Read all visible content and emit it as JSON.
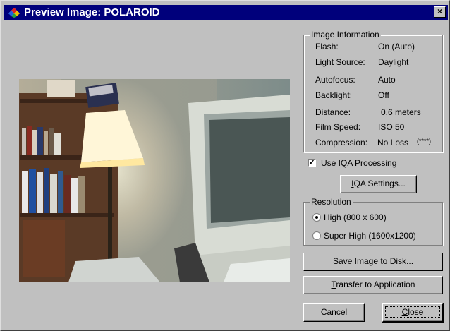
{
  "window": {
    "title": "Preview Image: POLAROID",
    "close_glyph": "×"
  },
  "image_information": {
    "legend": "Image Information",
    "rows": [
      {
        "label": "Flash:",
        "value": "On (Auto)"
      },
      {
        "label": "Light Source:",
        "value": "Daylight"
      },
      {
        "label": "Autofocus:",
        "value": "Auto"
      },
      {
        "label": "Backlight:",
        "value": "Off"
      },
      {
        "label": "Distance:",
        "value": "0.6 meters"
      },
      {
        "label": "Film Speed:",
        "value": "ISO 50"
      },
      {
        "label": "Compression:",
        "value": "No Loss"
      }
    ],
    "compression_stars": "(****)"
  },
  "iqa": {
    "checkbox_label": "Use IQA Processing",
    "checked": true,
    "settings_button": "IQA Settings..."
  },
  "resolution": {
    "legend": "Resolution",
    "options": [
      {
        "label": "High (800 x 600)",
        "selected": true
      },
      {
        "label": "Super High (1600x1200)",
        "selected": false
      }
    ]
  },
  "buttons": {
    "save": "Save Image to Disk...",
    "transfer": "Transfer to Application",
    "cancel": "Cancel",
    "close": "Close"
  },
  "colors": {
    "title_bar": "#00007b",
    "face": "#c0c0c0"
  }
}
